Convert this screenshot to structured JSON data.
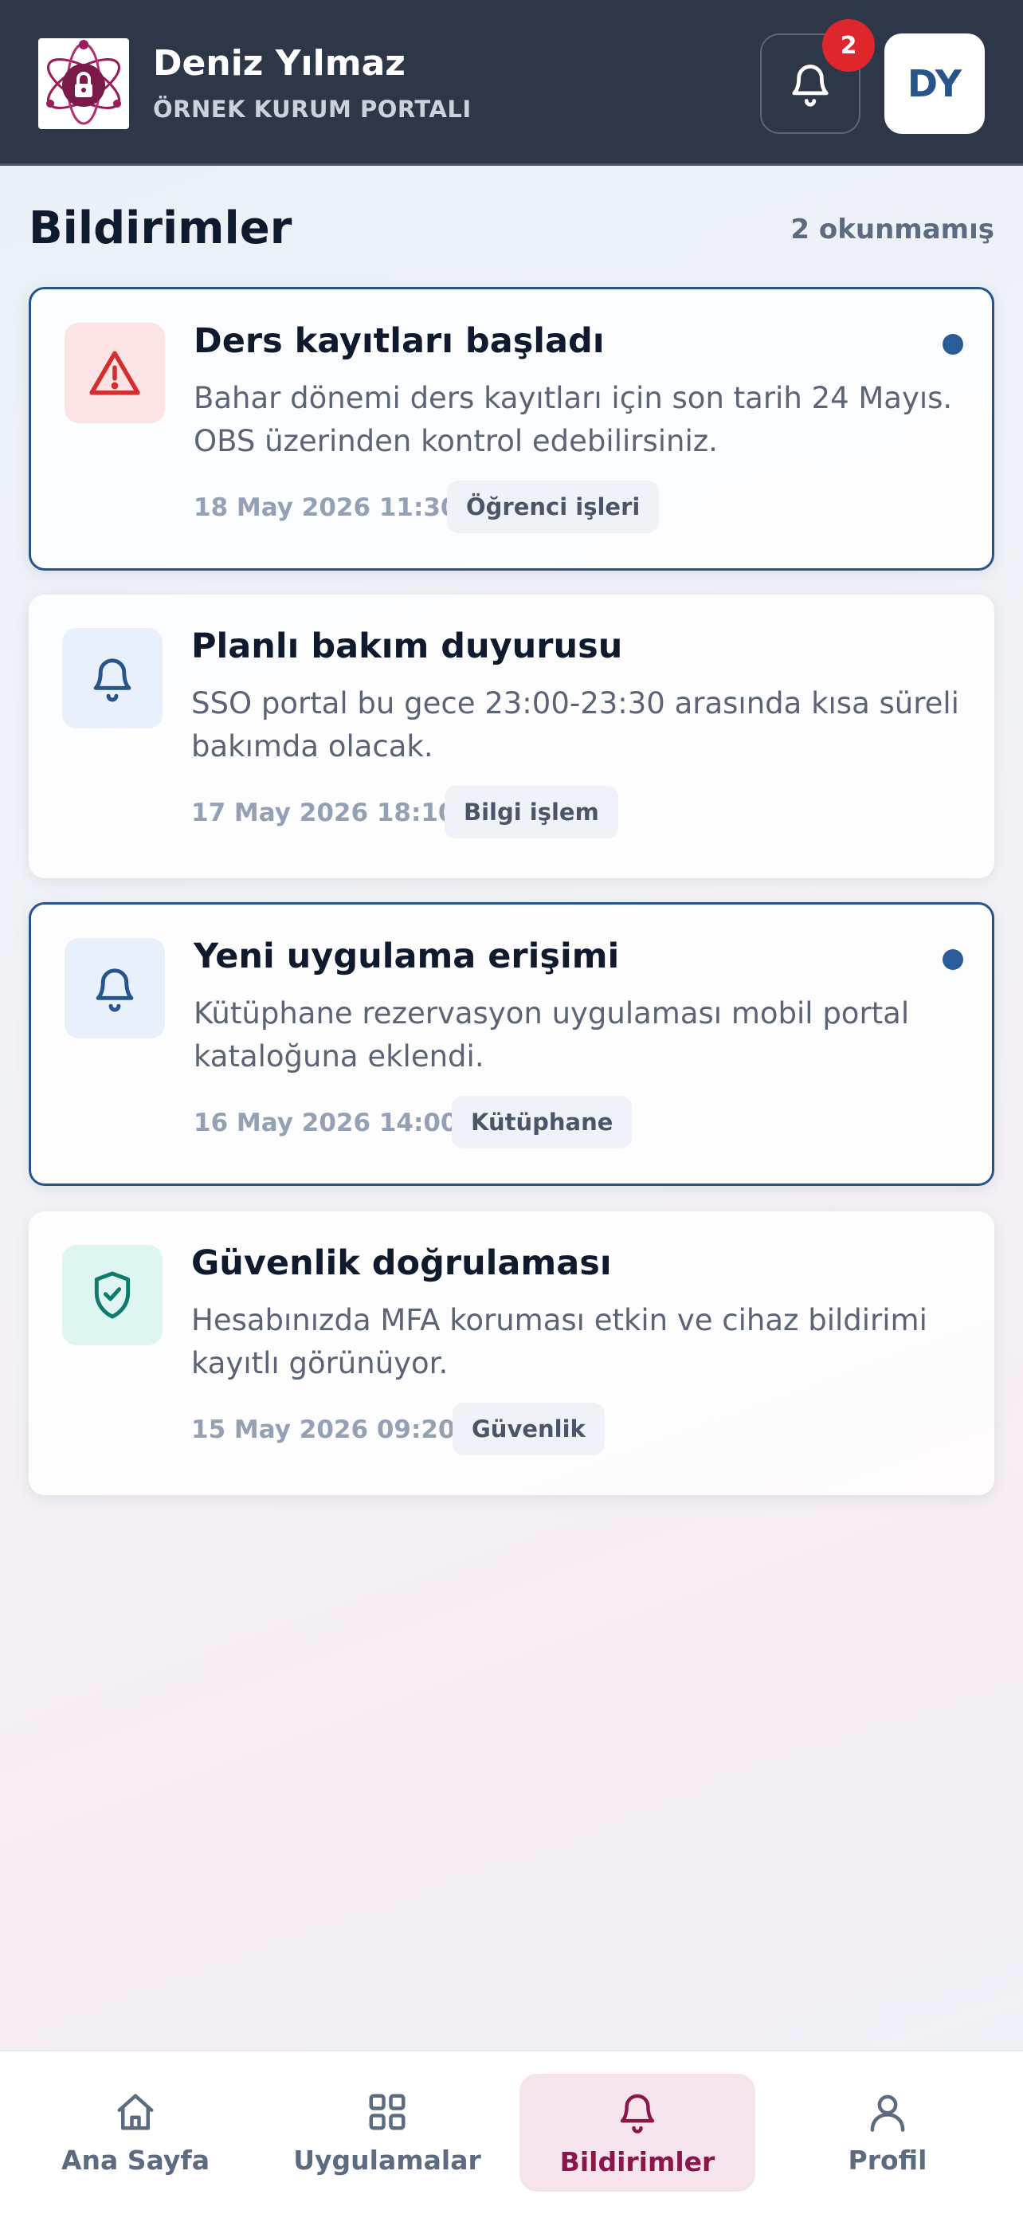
{
  "header": {
    "user_name": "Deniz Yılmaz",
    "org_name": "ÖRNEK KURUM PORTALI",
    "notification_badge": "2",
    "avatar_initials": "DY"
  },
  "page": {
    "title": "Bildirimler",
    "unread_count": "2 okunmamış"
  },
  "notifications": [
    {
      "title": "Ders kayıtları başladı",
      "body": "Bahar dönemi ders kayıtları için son tarih 24 Mayıs. OBS üzerinden kontrol edebilirsiniz.",
      "date": "18 May 2026 11:30",
      "tag": "Öğrenci işleri",
      "icon": "warning-icon",
      "unread": true
    },
    {
      "title": "Planlı bakım duyurusu",
      "body": "SSO portal bu gece 23:00-23:30 arasında kısa süreli bakımda olacak.",
      "date": "17 May 2026 18:10",
      "tag": "Bilgi işlem",
      "icon": "bell-icon",
      "unread": false
    },
    {
      "title": "Yeni uygulama erişimi",
      "body": "Kütüphane rezervasyon uygulaması mobil portal kataloğuna eklendi.",
      "date": "16 May 2026 14:00",
      "tag": "Kütüphane",
      "icon": "bell-icon",
      "unread": true
    },
    {
      "title": "Güvenlik doğrulaması",
      "body": "Hesabınızda MFA koruması etkin ve cihaz bildirimi kayıtlı görünüyor.",
      "date": "15 May 2026 09:20",
      "tag": "Güvenlik",
      "icon": "shield-check-icon",
      "unread": false
    }
  ],
  "bottom_nav": [
    {
      "label": "Ana Sayfa",
      "icon": "home-icon"
    },
    {
      "label": "Uygulamalar",
      "icon": "grid-icon"
    },
    {
      "label": "Bildirimler",
      "icon": "bell-icon",
      "active": true
    },
    {
      "label": "Profil",
      "icon": "user-icon"
    }
  ],
  "colors": {
    "header_bg": "#2d3748",
    "accent": "#27548a",
    "brand": "#8b1648",
    "warning": "#d32f2f",
    "success": "#0f7b6c"
  }
}
